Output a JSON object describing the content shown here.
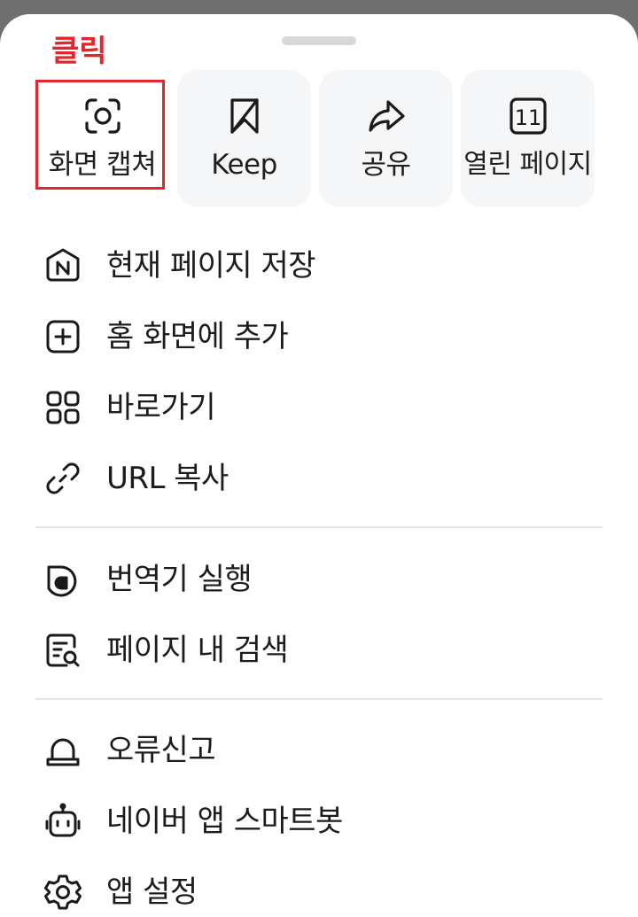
{
  "annotation": {
    "click_label": "클릭",
    "color": "#e3262b"
  },
  "quick_actions": [
    {
      "label": "화면 캡쳐",
      "icon": "camera-capture-icon"
    },
    {
      "label": "Keep",
      "icon": "bookmark-icon"
    },
    {
      "label": "공유",
      "icon": "share-arrow-icon"
    },
    {
      "label": "열린 페이지",
      "icon": "tab-count-icon",
      "badge": "11"
    }
  ],
  "menu_group1": [
    {
      "label": "현재 페이지 저장",
      "icon": "naver-save-icon"
    },
    {
      "label": "홈 화면에 추가",
      "icon": "add-home-icon"
    },
    {
      "label": "바로가기",
      "icon": "grid-shortcut-icon"
    },
    {
      "label": "URL 복사",
      "icon": "link-icon"
    }
  ],
  "menu_group2": [
    {
      "label": "번역기 실행",
      "icon": "translator-icon"
    },
    {
      "label": "페이지 내 검색",
      "icon": "find-in-page-icon"
    }
  ],
  "menu_group3": [
    {
      "label": "오류신고",
      "icon": "alarm-bell-icon"
    },
    {
      "label": "네이버 앱 스마트봇",
      "icon": "robot-icon"
    },
    {
      "label": "앱 설정",
      "icon": "gear-icon"
    }
  ]
}
